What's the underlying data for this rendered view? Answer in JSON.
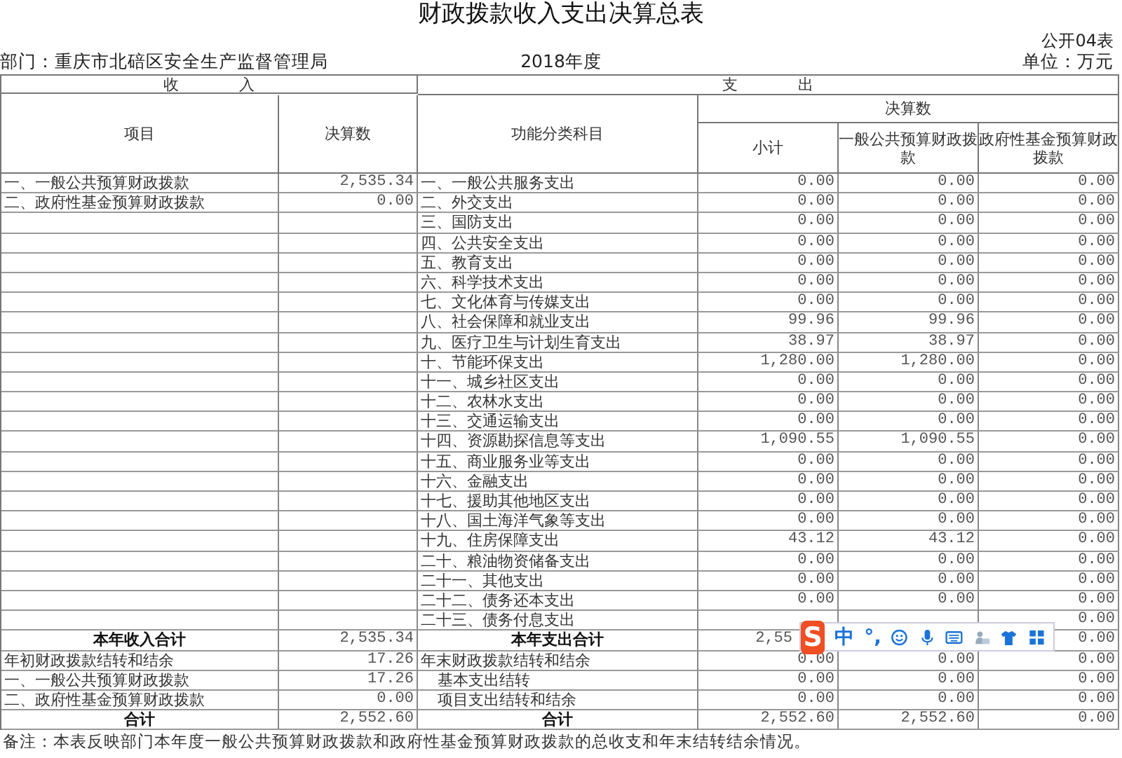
{
  "title": "财政拨款收入支出决算总表",
  "form_no": "公开04表",
  "department": "部门：重庆市北碚区安全生产监督管理局",
  "year": "2018年度",
  "unit": "单位：万元",
  "header": {
    "income": "收 入",
    "expense": "支 出",
    "item": "项目",
    "amount": "决算数",
    "function": "功能分类科目",
    "final": "决算数",
    "subtotal": "小计",
    "general": "一般公共预算财政拨款",
    "fund": "政府性基金预算财政拨款"
  },
  "rows": [
    {
      "kind": "item",
      "income_label": "一、一般公共预算财政拨款",
      "income_amount": "2,535.34",
      "expense_label": "一、一般公共服务支出",
      "subtotal": "0.00",
      "general": "0.00",
      "fund": "0.00"
    },
    {
      "kind": "item",
      "income_label": "二、政府性基金预算财政拨款",
      "income_amount": "0.00",
      "expense_label": "二、外交支出",
      "subtotal": "0.00",
      "general": "0.00",
      "fund": "0.00"
    },
    {
      "kind": "item",
      "expense_label": "三、国防支出",
      "subtotal": "0.00",
      "general": "0.00",
      "fund": "0.00"
    },
    {
      "kind": "item",
      "expense_label": "四、公共安全支出",
      "subtotal": "0.00",
      "general": "0.00",
      "fund": "0.00"
    },
    {
      "kind": "item",
      "expense_label": "五、教育支出",
      "subtotal": "0.00",
      "general": "0.00",
      "fund": "0.00"
    },
    {
      "kind": "item",
      "expense_label": "六、科学技术支出",
      "subtotal": "0.00",
      "general": "0.00",
      "fund": "0.00"
    },
    {
      "kind": "item",
      "expense_label": "七、文化体育与传媒支出",
      "subtotal": "0.00",
      "general": "0.00",
      "fund": "0.00"
    },
    {
      "kind": "item",
      "expense_label": "八、社会保障和就业支出",
      "subtotal": "99.96",
      "general": "99.96",
      "fund": "0.00"
    },
    {
      "kind": "item",
      "expense_label": "九、医疗卫生与计划生育支出",
      "subtotal": "38.97",
      "general": "38.97",
      "fund": "0.00"
    },
    {
      "kind": "item",
      "expense_label": "十、节能环保支出",
      "subtotal": "1,280.00",
      "general": "1,280.00",
      "fund": "0.00"
    },
    {
      "kind": "item",
      "expense_label": "十一、城乡社区支出",
      "subtotal": "0.00",
      "general": "0.00",
      "fund": "0.00"
    },
    {
      "kind": "item",
      "expense_label": "十二、农林水支出",
      "subtotal": "0.00",
      "general": "0.00",
      "fund": "0.00"
    },
    {
      "kind": "item",
      "expense_label": "十三、交通运输支出",
      "subtotal": "0.00",
      "general": "0.00",
      "fund": "0.00"
    },
    {
      "kind": "item",
      "expense_label": "十四、资源勘探信息等支出",
      "subtotal": "1,090.55",
      "general": "1,090.55",
      "fund": "0.00"
    },
    {
      "kind": "item",
      "expense_label": "十五、商业服务业等支出",
      "subtotal": "0.00",
      "general": "0.00",
      "fund": "0.00"
    },
    {
      "kind": "item",
      "expense_label": "十六、金融支出",
      "subtotal": "0.00",
      "general": "0.00",
      "fund": "0.00"
    },
    {
      "kind": "item",
      "expense_label": "十七、援助其他地区支出",
      "subtotal": "0.00",
      "general": "0.00",
      "fund": "0.00"
    },
    {
      "kind": "item",
      "expense_label": "十八、国土海洋气象等支出",
      "subtotal": "0.00",
      "general": "0.00",
      "fund": "0.00"
    },
    {
      "kind": "item",
      "expense_label": "十九、住房保障支出",
      "subtotal": "43.12",
      "general": "43.12",
      "fund": "0.00"
    },
    {
      "kind": "item",
      "expense_label": "二十、粮油物资储备支出",
      "subtotal": "0.00",
      "general": "0.00",
      "fund": "0.00"
    },
    {
      "kind": "item",
      "expense_label": "二十一、其他支出",
      "subtotal": "0.00",
      "general": "0.00",
      "fund": "0.00"
    },
    {
      "kind": "item",
      "expense_label": "二十二、债务还本支出",
      "subtotal": "0.00",
      "general": "0.00",
      "fund": "0.00"
    },
    {
      "kind": "item",
      "expense_label": "二十三、债务付息支出",
      "fund": "0.00"
    },
    {
      "kind": "total",
      "clipped": true,
      "income_label": "本年收入合计",
      "income_amount": "2,535.34",
      "expense_label": "本年支出合计",
      "subtotal": "2,55",
      "fund": "0.00"
    },
    {
      "kind": "item",
      "income_label": "年初财政拨款结转和结余",
      "income_amount": "17.26",
      "expense_label": "年末财政拨款结转和结余",
      "subtotal": "0.00",
      "general": "0.00",
      "fund": "0.00"
    },
    {
      "kind": "sub",
      "income_label": "一、一般公共预算财政拨款",
      "income_amount": "17.26",
      "expense_label": "基本支出结转",
      "subtotal": "0.00",
      "general": "0.00",
      "fund": "0.00"
    },
    {
      "kind": "sub",
      "income_label": "二、政府性基金预算财政拨款",
      "income_amount": "0.00",
      "expense_label": "项目支出结转和结余",
      "subtotal": "0.00",
      "general": "0.00",
      "fund": "0.00"
    },
    {
      "kind": "total",
      "income_label": "合计",
      "income_amount": "2,552.60",
      "expense_label": "合计",
      "subtotal": "2,552.60",
      "general": "2,552.60",
      "fund": "0.00"
    }
  ],
  "note": "备注：本表反映部门本年度一般公共预算财政拨款和政府性基金预算财政拨款的总收支和年末结转结余情况。",
  "ime": {
    "logo": "S",
    "mode": "中",
    "punct": "°,"
  }
}
